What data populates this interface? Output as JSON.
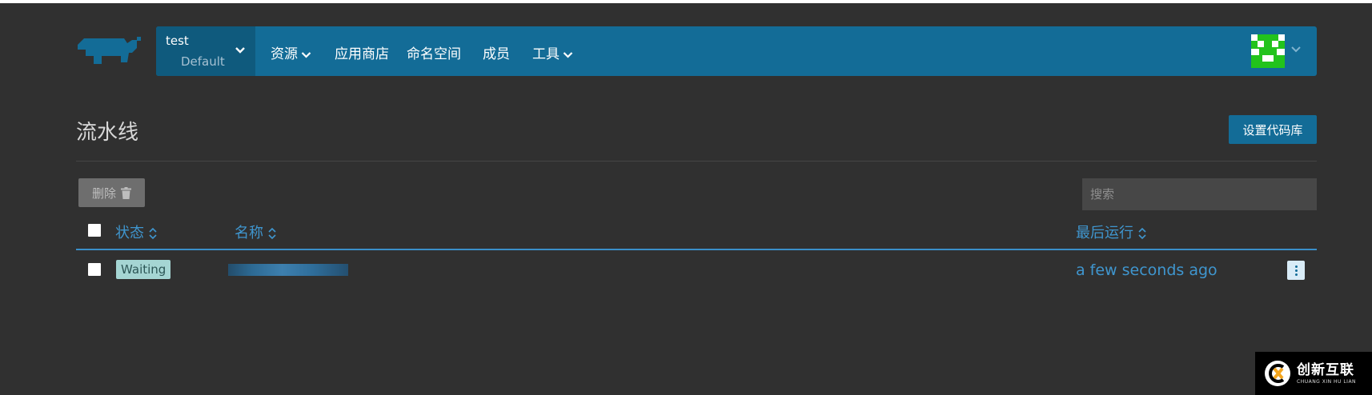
{
  "nav": {
    "project_name": "test",
    "namespace": "Default",
    "items": [
      "资源",
      "应用商店",
      "命名空间",
      "成员",
      "工具"
    ]
  },
  "page": {
    "title": "流水线",
    "primary_button": "设置代码库",
    "delete_button": "删除",
    "search_placeholder": "搜索"
  },
  "table": {
    "columns": {
      "status": "状态",
      "name": "名称",
      "last_run": "最后运行"
    },
    "rows": [
      {
        "status": "Waiting",
        "name": "",
        "last_run": "a few seconds ago"
      }
    ]
  },
  "watermark": {
    "cn": "创新互联",
    "en": "CHUANG XIN HU LIAN"
  },
  "colors": {
    "nav_bg": "#136c97",
    "link": "#3f96cf",
    "badge_waiting": "#a5d5d3",
    "avatar": "#22c31c"
  },
  "icons": [
    "rancher-logo-icon",
    "chevron-down-icon",
    "user-avatar-icon",
    "trash-icon",
    "sort-icon",
    "kebab-menu-icon"
  ]
}
